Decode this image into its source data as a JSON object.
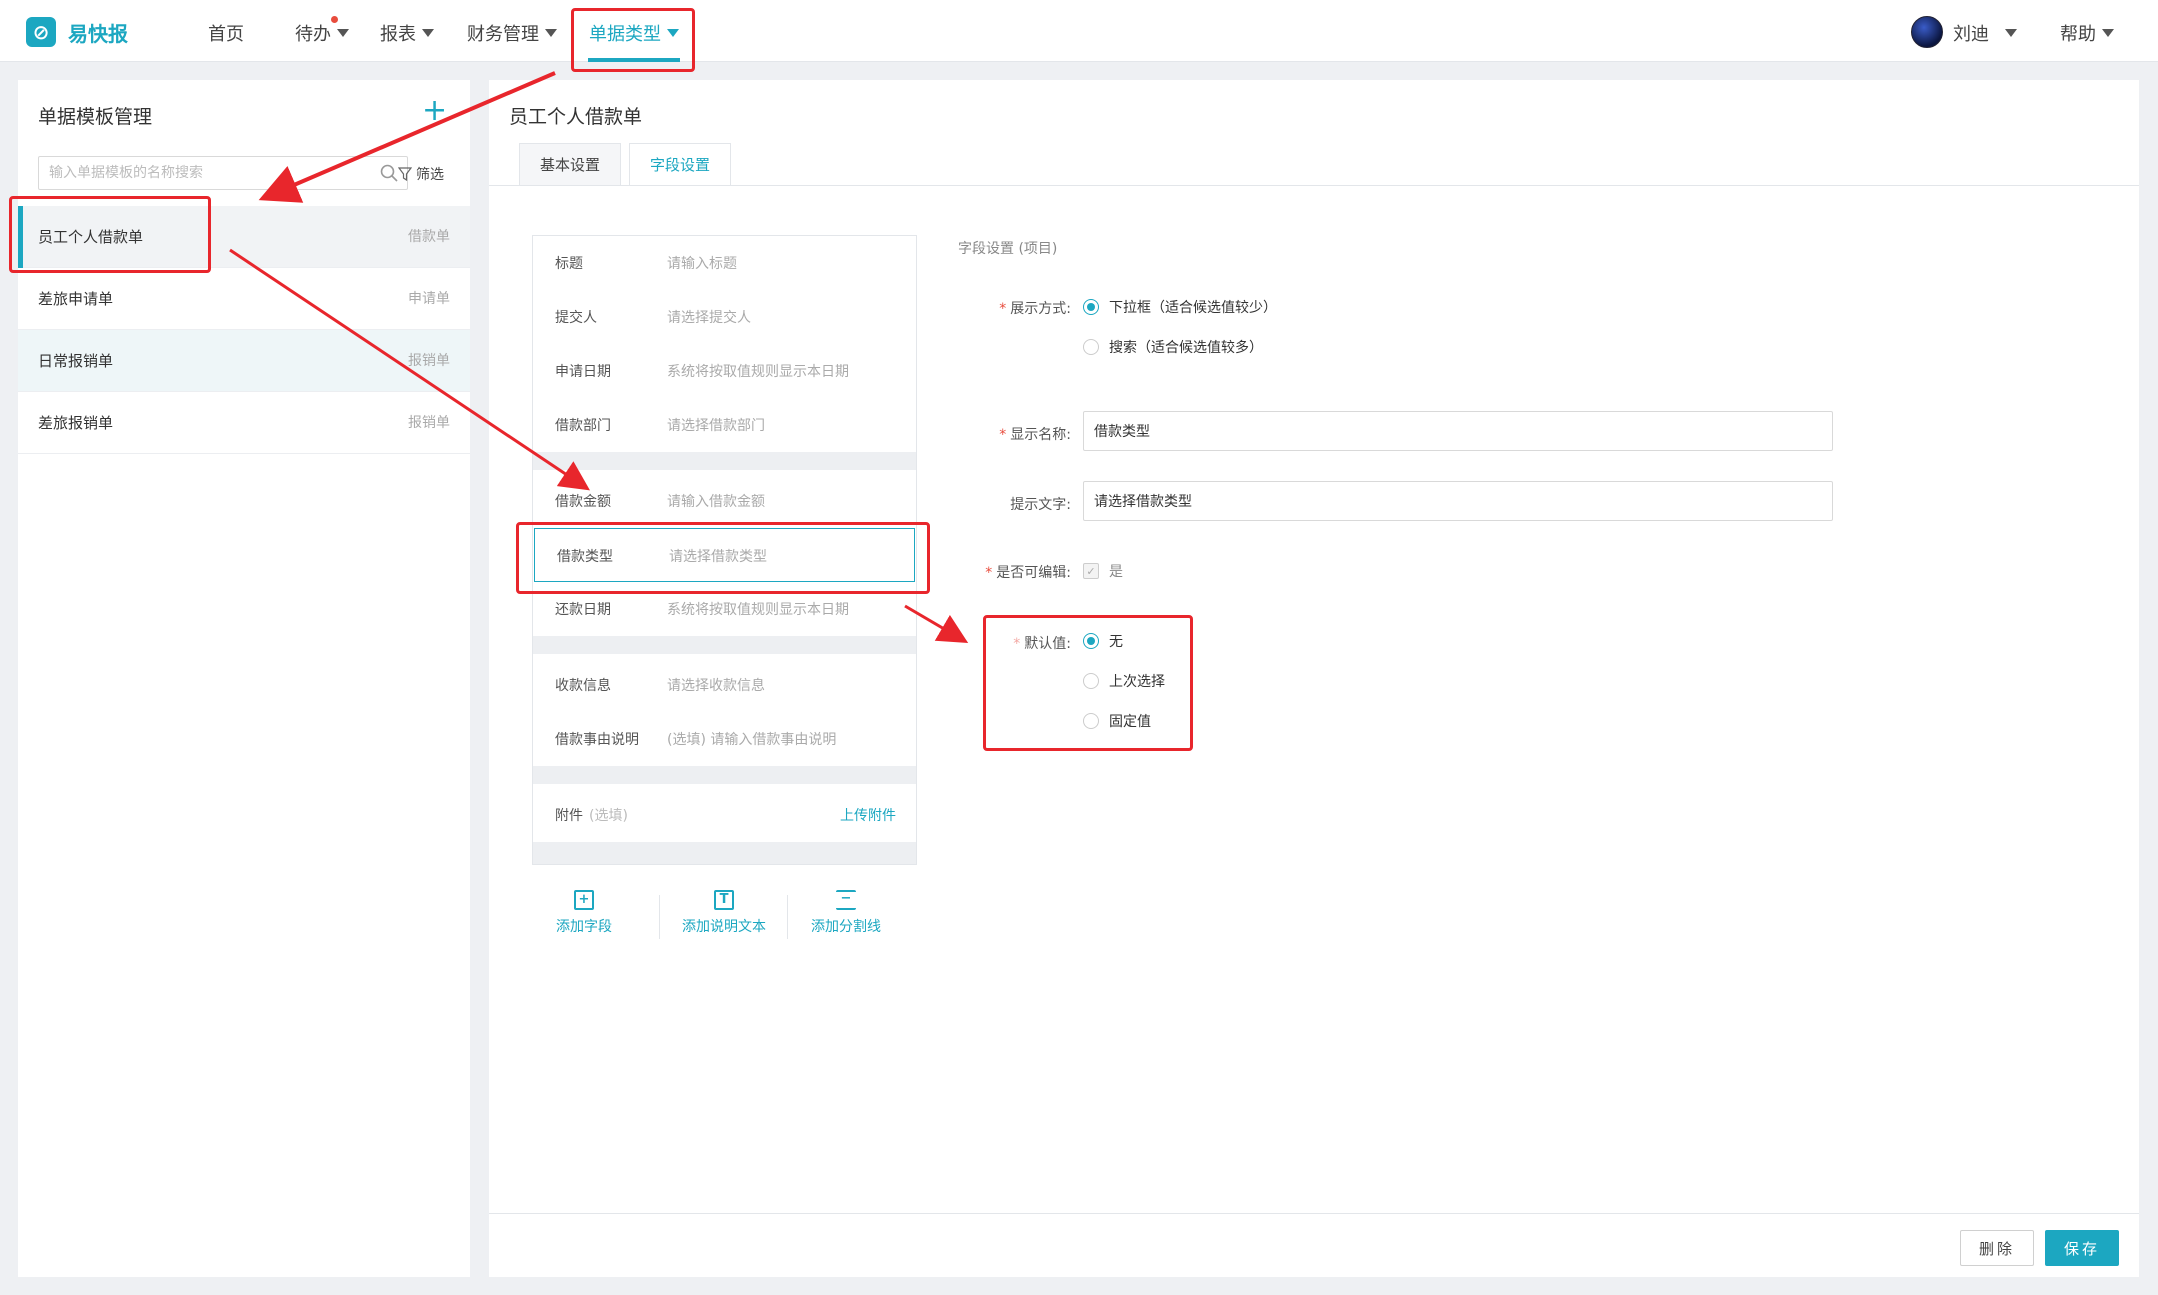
{
  "app": {
    "logo_text": "易快报"
  },
  "nav": {
    "home": "首页",
    "todo": "待办",
    "reports": "报表",
    "finance": "财务管理",
    "doc_types": "单据类型",
    "user_name": "刘迪",
    "help": "帮助"
  },
  "left": {
    "title": "单据模板管理",
    "add_symbol": "+",
    "search_placeholder": "输入单据模板的名称搜索",
    "filter_label": "筛选",
    "templates": [
      {
        "name": "员工个人借款单",
        "kind": "借款单"
      },
      {
        "name": "差旅申请单",
        "kind": "申请单"
      },
      {
        "name": "日常报销单",
        "kind": "报销单"
      },
      {
        "name": "差旅报销单",
        "kind": "报销单"
      }
    ]
  },
  "right": {
    "title": "员工个人借款单",
    "tabs": [
      "基本设置",
      "字段设置"
    ],
    "fields": [
      {
        "label": "标题",
        "placeholder": "请输入标题"
      },
      {
        "label": "提交人",
        "placeholder": "请选择提交人"
      },
      {
        "label": "申请日期",
        "placeholder": "系统将按取值规则显示本日期"
      },
      {
        "label": "借款部门",
        "placeholder": "请选择借款部门"
      },
      {
        "label": "借款金额",
        "placeholder": "请输入借款金额"
      },
      {
        "label": "借款类型",
        "placeholder": "请选择借款类型"
      },
      {
        "label": "还款日期",
        "placeholder": "系统将按取值规则显示本日期"
      },
      {
        "label": "收款信息",
        "placeholder": "请选择收款信息"
      },
      {
        "label": "借款事由说明",
        "placeholder": "(选填) 请输入借款事由说明"
      }
    ],
    "attachment": {
      "label": "附件",
      "optional": "(选填)",
      "link": "上传附件"
    },
    "tools": [
      "添加字段",
      "添加说明文本",
      "添加分割线"
    ],
    "settings": {
      "title": "字段设置 (项目)",
      "display_mode_label": "展示方式:",
      "display_modes": [
        "下拉框（适合候选值较少）",
        "搜索（适合候选值较多）"
      ],
      "display_name_label": "显示名称:",
      "display_name_value": "借款类型",
      "hint_label": "提示文字:",
      "hint_value": "请选择借款类型",
      "editable_label": "是否可编辑:",
      "editable_value": "是",
      "default_label": "默认值:",
      "default_options": [
        "无",
        "上次选择",
        "固定值"
      ]
    },
    "buttons": {
      "delete": "删除",
      "save": "保存"
    }
  },
  "colors": {
    "accent": "#1ca7c1",
    "annotation": "#e8262c",
    "notify_dot": "#e84c3d"
  }
}
